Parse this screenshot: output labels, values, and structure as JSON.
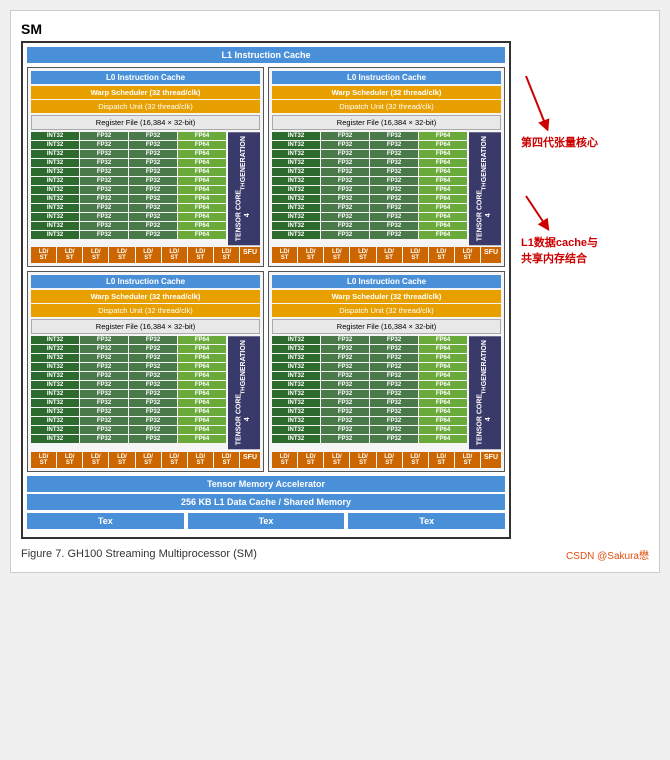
{
  "title": "SM",
  "l1_cache_top": "L1 Instruction Cache",
  "quadrants": [
    {
      "l0_cache": "L0 Instruction Cache",
      "warp_scheduler": "Warp Scheduler (32 thread/clk)",
      "dispatch_unit": "Dispatch Unit (32 thread/clk)",
      "register_file": "Register File (16,384 × 32-bit)",
      "tensor_core": "TENSOR CORE\n4TH GENERATION"
    },
    {
      "l0_cache": "L0 Instruction Cache",
      "warp_scheduler": "Warp Scheduler (32 thread/clk)",
      "dispatch_unit": "Dispatch Unit (32 thread/clk)",
      "register_file": "Register File (16,384 × 32-bit)",
      "tensor_core": "TENSOR CORE\n4TH GENERATION"
    },
    {
      "l0_cache": "L0 Instruction Cache",
      "warp_scheduler": "Warp Scheduler (32 thread/clk)",
      "dispatch_unit": "Dispatch Unit (32 thread/clk)",
      "register_file": "Register File (16,384 × 32-bit)",
      "tensor_core": "TENSOR CORE\n4TH GENERATION"
    },
    {
      "l0_cache": "L0 Instruction Cache",
      "warp_scheduler": "Warp Scheduler (32 thread/clk)",
      "dispatch_unit": "Dispatch Unit (32 thread/clk)",
      "register_file": "Register File (16,384 × 32-bit)",
      "tensor_core": "TENSOR CORE\n4TH GENERATION"
    }
  ],
  "tensor_memory_acc": "Tensor Memory Accelerator",
  "l1_data_cache": "256 KB L1 Data Cache / Shared Memory",
  "tex_labels": [
    "Tex",
    "Tex",
    "Tex"
  ],
  "reg_rows": [
    [
      "INT32",
      "FP32",
      "FP32",
      "FP64"
    ],
    [
      "INT32",
      "FP32",
      "FP32",
      "FP64"
    ],
    [
      "INT32",
      "FP32",
      "FP32",
      "FP64"
    ],
    [
      "INT32",
      "FP32",
      "FP32",
      "FP64"
    ],
    [
      "INT32",
      "FP32",
      "FP32",
      "FP64"
    ],
    [
      "INT32",
      "FP32",
      "FP32",
      "FP64"
    ],
    [
      "INT32",
      "FP32",
      "FP32",
      "FP64"
    ],
    [
      "INT32",
      "FP32",
      "FP32",
      "FP64"
    ],
    [
      "INT32",
      "FP32",
      "FP32",
      "FP64"
    ],
    [
      "INT32",
      "FP32",
      "FP32",
      "FP64"
    ],
    [
      "INT32",
      "FP32",
      "FP32",
      "FP64"
    ],
    [
      "INT32",
      "FP32",
      "FP32",
      "FP64"
    ]
  ],
  "sfu_cells": [
    "LD/ST",
    "LD/ST",
    "LD/ST",
    "LD/ST",
    "LD/ST",
    "LD/ST",
    "LD/ST",
    "LD/ST"
  ],
  "sfu_label": "SFU",
  "annotations": {
    "right1": "第四代张量核心",
    "right2": "L1数据cache与\n共享内存结合"
  },
  "figure_caption": "Figure 7.    GH100 Streaming Multiprocessor (SM)",
  "csdn_credit": "CSDN @Sakura懋"
}
